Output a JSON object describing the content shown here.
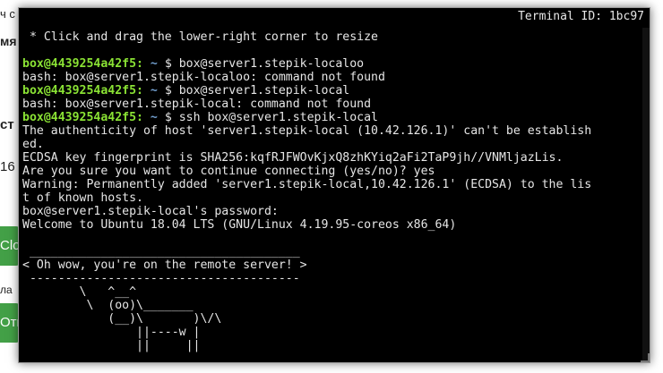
{
  "background": {
    "fragments": [
      "ч с",
      "мя",
      "ст",
      "16",
      "Clo",
      "ла",
      "Отп"
    ]
  },
  "terminal": {
    "title": "Terminal ID: 1bc97",
    "lines": [
      {
        "text": " * Click and drag the lower-right corner to resize"
      },
      {
        "text": ""
      },
      {
        "prompt": "box@4439254a42f5:",
        "path": " ~ ",
        "text": "$ box@server1.stepik-localoo"
      },
      {
        "text": "bash: box@server1.stepik-localoo: command not found"
      },
      {
        "prompt": "box@4439254a42f5:",
        "path": " ~ ",
        "text": "$ box@server1.stepik-local"
      },
      {
        "text": "bash: box@server1.stepik-local: command not found"
      },
      {
        "prompt": "box@4439254a42f5:",
        "path": " ~ ",
        "text": "$ ssh box@server1.stepik-local"
      },
      {
        "text": "The authenticity of host 'server1.stepik-local (10.42.126.1)' can't be establish"
      },
      {
        "text": "ed."
      },
      {
        "text": "ECDSA key fingerprint is SHA256:kqfRJFWOvKjxQ8zhKYiq2aFi2TaP9jh//VNMljazLis."
      },
      {
        "text": "Are you sure you want to continue connecting (yes/no)? yes"
      },
      {
        "text": "Warning: Permanently added 'server1.stepik-local,10.42.126.1' (ECDSA) to the lis"
      },
      {
        "text": "t of known hosts."
      },
      {
        "text": "box@server1.stepik-local's password:"
      },
      {
        "text": "Welcome to Ubuntu 18.04 LTS (GNU/Linux 4.19.95-coreos x86_64)"
      },
      {
        "text": ""
      },
      {
        "text": " ______________________________________"
      },
      {
        "text": "< Oh wow, you're on the remote server! >"
      },
      {
        "text": " --------------------------------------"
      },
      {
        "text": "        \\   ^__^"
      },
      {
        "text": "         \\  (oo)\\_______"
      },
      {
        "text": "            (__)\\       )\\/\\"
      },
      {
        "text": "                ||----w |"
      },
      {
        "text": "                ||     ||"
      }
    ]
  }
}
